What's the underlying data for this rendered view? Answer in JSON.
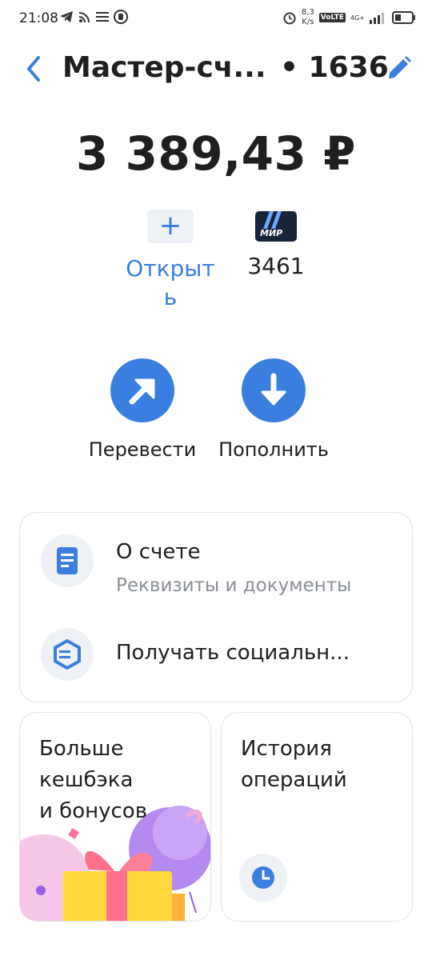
{
  "status_bar": {
    "time": "21:08",
    "speed_value": "8,3",
    "speed_unit": "K/s",
    "volte": "VoLTE",
    "network": "4G+",
    "icons": [
      "telegram-icon",
      "cast-icon",
      "menu-lines-icon",
      "hand-icon",
      "alarm-icon",
      "signal-icon",
      "battery-icon"
    ]
  },
  "header": {
    "title": "Мастер-сч...",
    "account_number": "• 1636"
  },
  "balance": "3 389,43 ₽",
  "cards": {
    "open_label": "Открыть",
    "mir_brand": "МИР",
    "mir_card_number": "3461"
  },
  "actions": {
    "transfer_label": "Перевести",
    "topup_label": "Пополнить"
  },
  "info": {
    "account_title": "О счете",
    "account_subtitle": "Реквизиты и документы",
    "social_title": "Получать социальн..."
  },
  "tiles": {
    "cashback_text": "Больше\nкешбэка\nи бонусов",
    "history_text": "История\nопераций"
  },
  "colors": {
    "accent": "#3a7fe0",
    "text": "#1f1f1f",
    "muted": "#8a8f98",
    "icon_bg": "#eef1f5"
  }
}
